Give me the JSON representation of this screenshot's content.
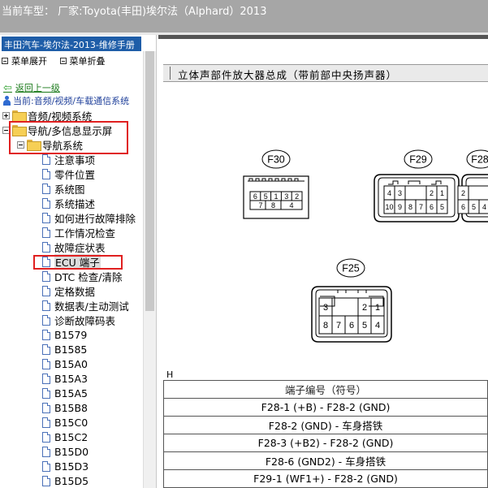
{
  "window": {
    "title": "当前车型：  厂家:Toyota(丰田)埃尔法（Alphard）2013"
  },
  "left_pane": {
    "manual_title": "丰田汽车-埃尔法-2013-维修手册",
    "expand_all": "菜单展开",
    "collapse_all": "菜单折叠",
    "back_link": "返回上一级",
    "current_location": "当前:音频/视频/车载通信系统",
    "tree": {
      "audio_video": "音频/视频系统",
      "nav_display": "导航/多信息显示屏",
      "nav_system": "导航系统",
      "items": [
        "注意事项",
        "零件位置",
        "系统图",
        "系统描述",
        "如何进行故障排除",
        "工作情况检查",
        "故障症状表",
        "ECU 端子",
        "DTC 检查/清除",
        "定格数据",
        "数据表/主动测试",
        "诊断故障码表",
        "B1579",
        "B1585",
        "B15A0",
        "B15A3",
        "B15A5",
        "B15B8",
        "B15C0",
        "B15C2",
        "B15D0",
        "B15D3",
        "B15D5"
      ],
      "selected_item": "ECU 端子"
    }
  },
  "right_pane": {
    "section_title": "立体声部件放大器总成（带前部中央扬声器）",
    "connectors": {
      "f30": {
        "label": "F30",
        "row1": [
          "6",
          "5",
          "1",
          "3",
          "2"
        ],
        "row2": [
          "7",
          "8",
          "4"
        ]
      },
      "f29": {
        "label": "F29",
        "row1": [
          "4",
          "3",
          "2",
          "1"
        ],
        "row2": [
          "10",
          "9",
          "8",
          "7",
          "6",
          "5"
        ]
      },
      "f28": {
        "label": "F28",
        "row1": [
          "2"
        ],
        "row2": [
          "6",
          "5",
          "4"
        ]
      },
      "f25": {
        "label": "F25",
        "row1": [
          "3",
          "2",
          "1"
        ],
        "row2": [
          "8",
          "7",
          "6",
          "5",
          "4"
        ]
      }
    },
    "h_label": "H",
    "table": {
      "header": "端子编号（符号）",
      "rows": [
        "F28-1 (+B) - F28-2 (GND)",
        "F28-2 (GND) - 车身搭铁",
        "F28-3 (+B2) - F28-2 (GND)",
        "F28-6 (GND2) - 车身搭铁",
        "F29-1 (WF1+) - F28-2 (GND)"
      ]
    }
  }
}
